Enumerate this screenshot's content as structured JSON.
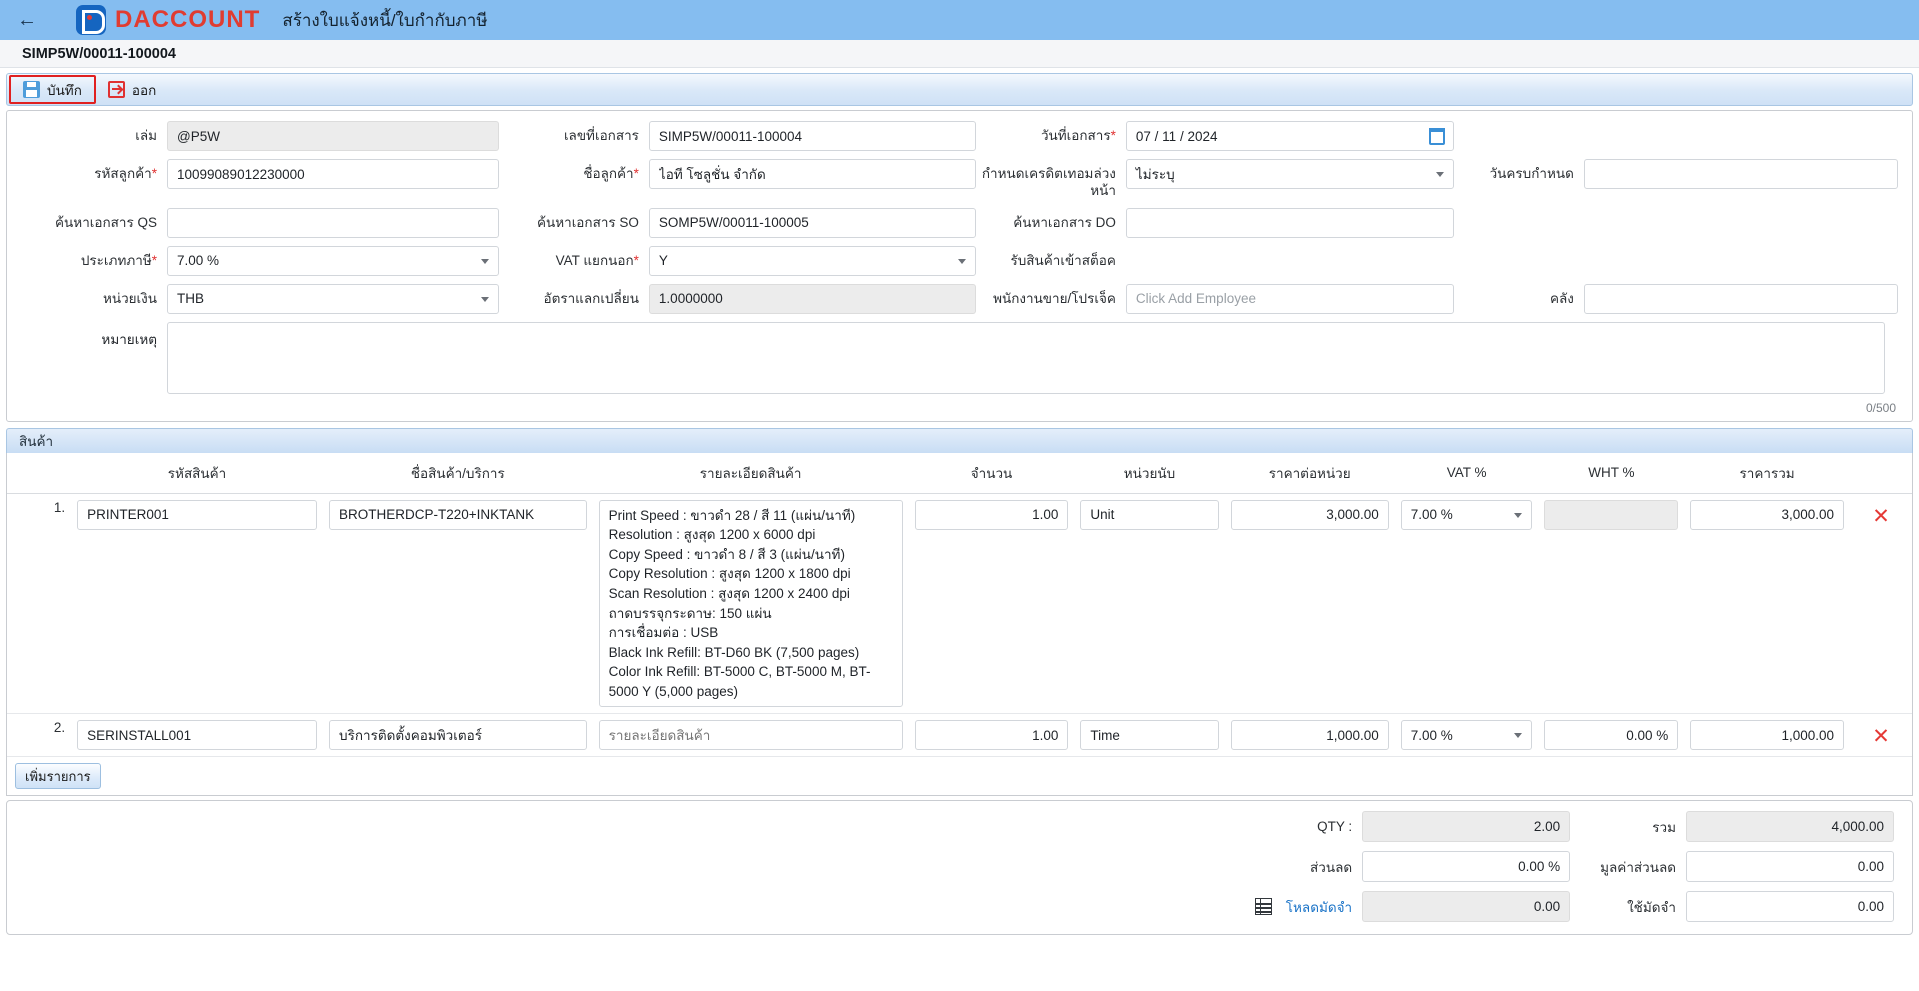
{
  "appbar": {
    "back_icon": "arrow-left-icon",
    "brand": "DACCOUNT",
    "title": "สร้างใบแจ้งหนี้/ใบกำกับภาษี"
  },
  "docstrip": {
    "doc_no": "SIMP5W/00011-100004"
  },
  "toolbar": {
    "save_label": "บันทึก",
    "exit_label": "ออก"
  },
  "form": {
    "book_label": "เล่ม",
    "book_value": "@P5W",
    "doc_no_label": "เลขที่เอกสาร",
    "doc_no_value": "SIMP5W/00011-100004",
    "doc_date_label": "วันที่เอกสาร",
    "doc_date_value": "07 / 11 / 2024",
    "credit_term_label": "กำหนดเครดิตเทอมล่วงหน้า",
    "credit_term_value": "ไม่ระบุ",
    "due_date_label": "วันครบกำหนด",
    "due_date_value": "",
    "cust_code_label": "รหัสลูกค้า",
    "cust_code_value": "10099089012230000",
    "cust_name_label": "ชื่อลูกค้า",
    "cust_name_value": "ไอที โซลูชั่น จำกัด",
    "qs_label": "ค้นหาเอกสาร QS",
    "qs_value": "",
    "so_label": "ค้นหาเอกสาร SO",
    "so_value": "SOMP5W/00011-100005",
    "do_label": "ค้นหาเอกสาร DO",
    "do_value": "",
    "tax_type_label": "ประเภทภาษี",
    "tax_type_value": "7.00 %",
    "vat_sep_label": "VAT แยกนอก",
    "vat_sep_value": "Y",
    "receive_stock_label": "รับสินค้าเข้าสต็อค",
    "receive_stock_checked": true,
    "currency_label": "หน่วยเงิน",
    "currency_value": "THB",
    "rate_label": "อัตราแลกเปลี่ยน",
    "rate_value": "1.0000000",
    "sales_label": "พนักงานขาย/โปรเจ็ค",
    "sales_placeholder": "Click Add Employee",
    "sales_value": "",
    "warehouse_label": "คลัง",
    "warehouse_value": "",
    "note_label": "หมายเหตุ",
    "note_value": "",
    "note_counter": "0/500"
  },
  "items": {
    "section_title": "สินค้า",
    "columns": {
      "code": "รหัสสินค้า",
      "name": "ชื่อสินค้า/บริการ",
      "desc": "รายละเอียดสินค้า",
      "qty": "จำนวน",
      "unit": "หน่วยนับ",
      "price": "ราคาต่อหน่วย",
      "vat": "VAT %",
      "wht": "WHT %",
      "total": "ราคารวม"
    },
    "desc_placeholder": "รายละเอียดสินค้า",
    "add_label": "เพิ่มรายการ",
    "delete_icon": "delete-x-icon",
    "rows": [
      {
        "no": "1.",
        "code": "PRINTER001",
        "name": "BROTHERDCP-T220+INKTANK",
        "desc": "Print Speed : ขาวดำ 28 / สี 11 (แผ่น/นาที)\nResolution : สูงสุด 1200 x 6000 dpi\nCopy Speed : ขาวดำ 8 / สี 3 (แผ่น/นาที)\nCopy Resolution : สูงสุด 1200 x 1800 dpi\nScan Resolution : สูงสุด 1200 x 2400 dpi\nถาดบรรจุกระดาษ: 150 แผ่น\nการเชื่อมต่อ : USB\nBlack Ink Refill: BT-D60 BK (7,500 pages)\nColor Ink Refill: BT-5000 C, BT-5000 M, BT-5000 Y (5,000 pages)",
        "desc_is_placeholder": false,
        "qty": "1.00",
        "unit": "Unit",
        "price": "3,000.00",
        "vat": "7.00 %",
        "wht": "",
        "wht_readonly": true,
        "total": "3,000.00"
      },
      {
        "no": "2.",
        "code": "SERINSTALL001",
        "name": "บริการติดตั้งคอมพิวเตอร์",
        "desc": "รายละเอียดสินค้า",
        "desc_is_placeholder": true,
        "qty": "1.00",
        "unit": "Time",
        "price": "1,000.00",
        "vat": "7.00 %",
        "wht": "0.00 %",
        "wht_readonly": false,
        "total": "1,000.00"
      }
    ]
  },
  "totals": {
    "qty_label": "QTY :",
    "qty_value": "2.00",
    "sum_label": "รวม",
    "sum_value": "4,000.00",
    "discount_label": "ส่วนลด",
    "discount_value": "0.00 %",
    "discount_amount_label": "มูลค่าส่วนลด",
    "discount_amount_value": "0.00",
    "load_deposit_label": "โหลดมัดจำ",
    "load_deposit_value": "0.00",
    "use_deposit_label": "ใช้มัดจำ",
    "use_deposit_value": "0.00",
    "grid_icon": "grid-list-icon"
  },
  "colors": {
    "appbar": "#85bdf0",
    "brand_red": "#e03c31",
    "accent_blue": "#1e88e5",
    "danger": "#e53935",
    "focus_outline": "#e02020"
  }
}
